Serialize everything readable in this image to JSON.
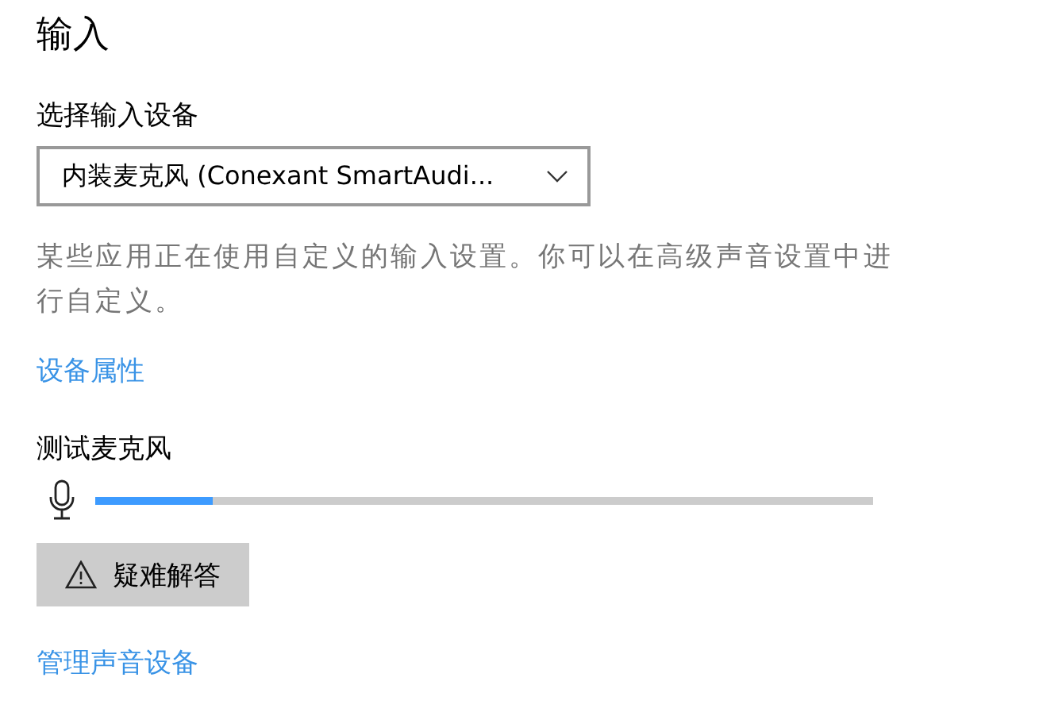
{
  "section_title": "输入",
  "device_label": "选择输入设备",
  "device_dropdown": {
    "value": "内装麦克风 (Conexant SmartAudi..."
  },
  "description": "某些应用正在使用自定义的输入设置。你可以在高级声音设置中进行自定义。",
  "device_properties_link": "设备属性",
  "test_label": "测试麦克风",
  "mic_meter": {
    "level": 0.15
  },
  "troubleshoot_button": {
    "label": "疑难解答"
  },
  "manage_devices_link": "管理声音设备"
}
